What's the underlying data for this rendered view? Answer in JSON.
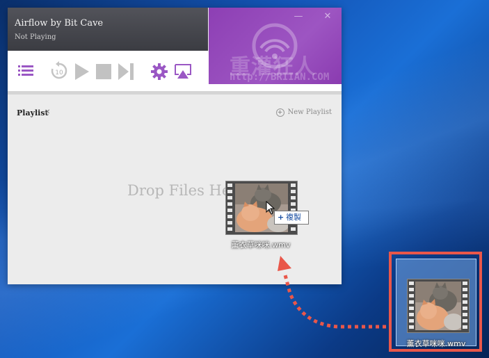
{
  "app": {
    "title": "Airflow by Bit Cave",
    "status": "Not Playing"
  },
  "window_controls": {
    "minimize": "—",
    "close": "✕"
  },
  "controls": {
    "rewind_seconds": "10"
  },
  "watermark": {
    "text_cn": "重灌狂人",
    "url": "http://BRIIAN.COM"
  },
  "playlist": {
    "tab_label": "Playlist",
    "close_glyph": "✕",
    "new_playlist_label": "New Playlist",
    "drop_hint": "Drop Files Here"
  },
  "drag": {
    "file_name": "薰衣草咪咪.wmv",
    "copy_label": "複製"
  },
  "desktop": {
    "file_name": "薰衣草咪咪.wmv"
  },
  "colors": {
    "accent_purple": "#9a57c4",
    "titlebar": "#45464c",
    "artwork_purple": "#9b4fc0",
    "highlight_red": "#e9574a",
    "desktop_blue": "#1456b8"
  },
  "icons": [
    "playlist-icon",
    "rewind-10-icon",
    "play-icon",
    "stop-icon",
    "next-icon",
    "settings-gear-icon",
    "airplay-icon",
    "cursor-icon",
    "copy-plus-icon",
    "video-file-icon"
  ]
}
